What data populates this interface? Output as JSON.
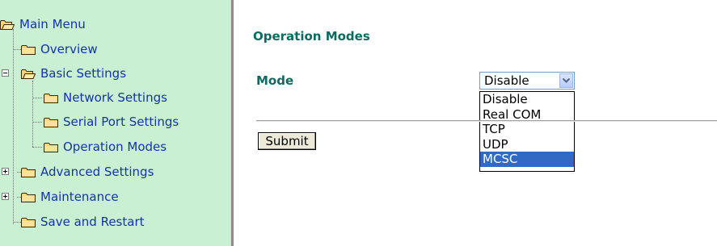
{
  "sidebar": {
    "items": [
      {
        "label": "Main Menu",
        "level": 0,
        "open": true
      },
      {
        "label": "Overview",
        "level": 1
      },
      {
        "label": "Basic Settings",
        "level": 1,
        "open": true,
        "expander": "minus"
      },
      {
        "label": "Network Settings",
        "level": 2
      },
      {
        "label": "Serial Port Settings",
        "level": 2
      },
      {
        "label": "Operation Modes",
        "level": 2
      },
      {
        "label": "Advanced Settings",
        "level": 1,
        "expander": "plus"
      },
      {
        "label": "Maintenance",
        "level": 1,
        "expander": "plus"
      },
      {
        "label": "Save and Restart",
        "level": 1
      }
    ],
    "colors": {
      "background": "#c9f0d3",
      "link": "#1533aa"
    }
  },
  "main": {
    "title": "Operation Modes",
    "mode_label": "Mode",
    "mode_select": {
      "value": "Disable",
      "options": [
        "Disable",
        "Real COM",
        "TCP",
        "UDP",
        "MCSC"
      ],
      "highlighted": "MCSC"
    },
    "submit_label": "Submit",
    "colors": {
      "heading": "#0c6a5e",
      "highlight": "#316ac5"
    }
  }
}
